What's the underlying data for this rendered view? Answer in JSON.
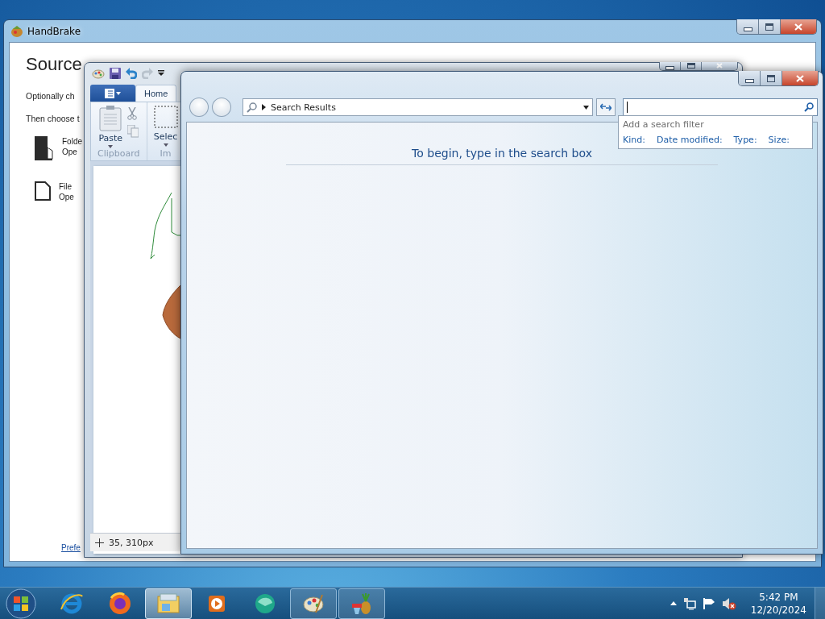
{
  "handbrake": {
    "title": "HandBrake",
    "heading": "Source",
    "lines": [
      "Optionally ch",
      "Then choose t"
    ],
    "sources": [
      {
        "kind": "folder",
        "title": "Folde",
        "subtitle": "Ope"
      },
      {
        "kind": "file",
        "title": "File",
        "subtitle": "Ope"
      }
    ],
    "link": "Prefe"
  },
  "paint": {
    "tabs": [
      {
        "label": "Home",
        "selected": true
      }
    ],
    "groups": [
      {
        "kind": "clipboard",
        "button": "Paste",
        "label": "Clipboard"
      },
      {
        "kind": "image",
        "button": "Selec",
        "label": "Im"
      }
    ],
    "status": "35, 310px"
  },
  "explorer": {
    "address": "Search Results",
    "filter_title": "Add a search filter",
    "filters": [
      "Kind:",
      "Date modified:",
      "Type:",
      "Size:"
    ],
    "message": "To begin, type in the search box"
  },
  "taskbar": {
    "apps": [
      {
        "kind": "ie",
        "running": false,
        "selected": false
      },
      {
        "kind": "firefox",
        "running": false,
        "selected": false
      },
      {
        "kind": "folder",
        "running": true,
        "selected": true
      },
      {
        "kind": "media",
        "running": false,
        "selected": false
      },
      {
        "kind": "green",
        "running": false,
        "selected": false
      },
      {
        "kind": "paint",
        "running": true,
        "selected": false
      },
      {
        "kind": "pineapple",
        "running": true,
        "selected": false
      }
    ],
    "time": "5:42 PM",
    "date": "12/20/2024"
  }
}
